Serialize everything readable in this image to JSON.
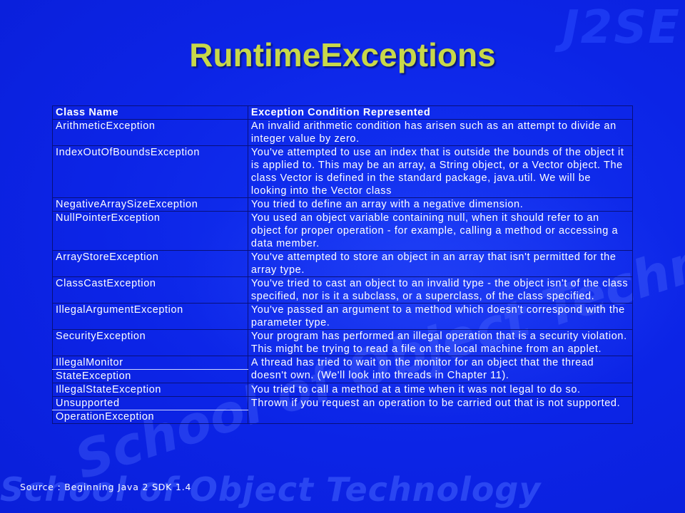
{
  "slide": {
    "title": "RuntimeExceptions",
    "watermark_logo": "J2SE",
    "watermark_school": "School of Object Technology",
    "source": "Source : Beginning Java 2 SDK 1.4"
  },
  "table": {
    "headers": [
      "Class Name",
      "Exception Condition Represented"
    ],
    "rows": [
      {
        "name": "ArithmeticException",
        "desc": "An invalid arithmetic condition has arisen such as an attempt to divide an integer value by zero."
      },
      {
        "name": "IndexOutOfBoundsException",
        "desc": "You've attempted to use an index that is outside the bounds of the object it is applied to. This may be an array, a String object, or a Vector object. The class Vector is defined in the standard package, java.util. We will be looking into the Vector class"
      },
      {
        "name": "NegativeArraySizeException",
        "desc": "You tried to define an array with a negative dimension."
      },
      {
        "name": "NullPointerException",
        "desc": "You used an object variable containing null, when it should refer to an object for proper operation - for example, calling a method or accessing a data member."
      },
      {
        "name": "ArrayStoreException",
        "desc": "You've attempted to store an object in an array that isn't permitted for the array type."
      },
      {
        "name": "ClassCastException",
        "desc": "You've tried to cast an object to an invalid type - the object isn't of the class specified, nor is it a subclass, or a superclass, of the class specified."
      },
      {
        "name": "IllegalArgumentException",
        "desc": "You've passed an argument to a method which doesn't correspond with the parameter type."
      },
      {
        "name": "SecurityException",
        "desc": "Your program has performed an illegal operation that is a security violation. This might be trying to read a file on the local machine from an applet."
      },
      {
        "name_a": "IllegalMonitor",
        "name_b": "StateException",
        "desc": "A thread has tried to wait on the monitor for an object that the thread doesn't own. (We'll look into threads in Chapter 11)."
      },
      {
        "name": "IllegalStateException",
        "desc": "You tried to call a method at a time when it was not legal to do so."
      },
      {
        "name_a": "Unsupported",
        "name_b": "OperationException",
        "desc": "Thrown if you request an operation to be carried out that is not supported."
      }
    ]
  }
}
